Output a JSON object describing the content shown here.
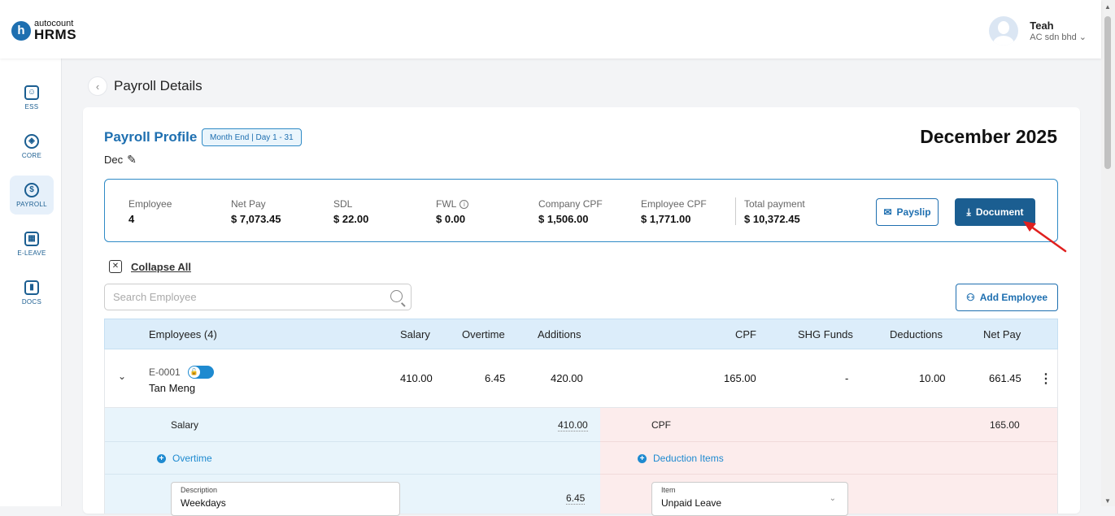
{
  "brand": {
    "small": "autocount",
    "big": "HRMS",
    "letter": "h"
  },
  "user": {
    "name": "Teah",
    "company": "AC sdn bhd"
  },
  "sidebar": {
    "items": [
      {
        "label": "ESS",
        "icon": "ess-icon"
      },
      {
        "label": "CORE",
        "icon": "core-icon"
      },
      {
        "label": "PAYROLL",
        "icon": "payroll-icon"
      },
      {
        "label": "E-LEAVE",
        "icon": "calendar-icon"
      },
      {
        "label": "DOCS",
        "icon": "docs-icon"
      }
    ]
  },
  "page": {
    "title": "Payroll Details"
  },
  "profile": {
    "title": "Payroll Profile",
    "badge": "Month End | Day 1 - 31",
    "name": "Dec",
    "period": "December 2025"
  },
  "summary": {
    "stats": [
      {
        "label": "Employee",
        "value": "4"
      },
      {
        "label": "Net Pay",
        "value": "$ 7,073.45"
      },
      {
        "label": "SDL",
        "value": "$ 22.00"
      },
      {
        "label": "FWL",
        "value": "$ 0.00"
      },
      {
        "label": "Company CPF",
        "value": "$ 1,506.00"
      },
      {
        "label": "Employee CPF",
        "value": "$ 1,771.00"
      },
      {
        "label": "Total payment",
        "value": "$ 10,372.45"
      }
    ],
    "payslip_label": "Payslip",
    "document_label": "Document"
  },
  "controls": {
    "collapse_label": "Collapse All",
    "search_placeholder": "Search Employee",
    "add_employee_label": "Add Employee"
  },
  "table": {
    "headers": {
      "employees": "Employees (4)",
      "salary": "Salary",
      "overtime": "Overtime",
      "additions": "Additions",
      "cpf": "CPF",
      "shg": "SHG Funds",
      "deductions": "Deductions",
      "net_pay": "Net Pay"
    },
    "rows": [
      {
        "id": "E-0001",
        "name": "Tan Meng",
        "salary": "410.00",
        "overtime": "6.45",
        "additions": "420.00",
        "cpf": "165.00",
        "shg": "-",
        "deductions": "10.00",
        "net_pay": "661.45"
      }
    ]
  },
  "detail": {
    "salary_label": "Salary",
    "salary_value": "410.00",
    "overtime_link": "Overtime",
    "description_label": "Description",
    "description_value": "Weekdays",
    "overtime_value": "6.45",
    "cpf_label": "CPF",
    "cpf_value": "165.00",
    "deduction_link": "Deduction Items",
    "item_label": "Item",
    "item_value": "Unpaid Leave"
  },
  "colors": {
    "primary": "#1b5e91",
    "accent": "#1e8ad0",
    "annotation": "#e0201f"
  }
}
